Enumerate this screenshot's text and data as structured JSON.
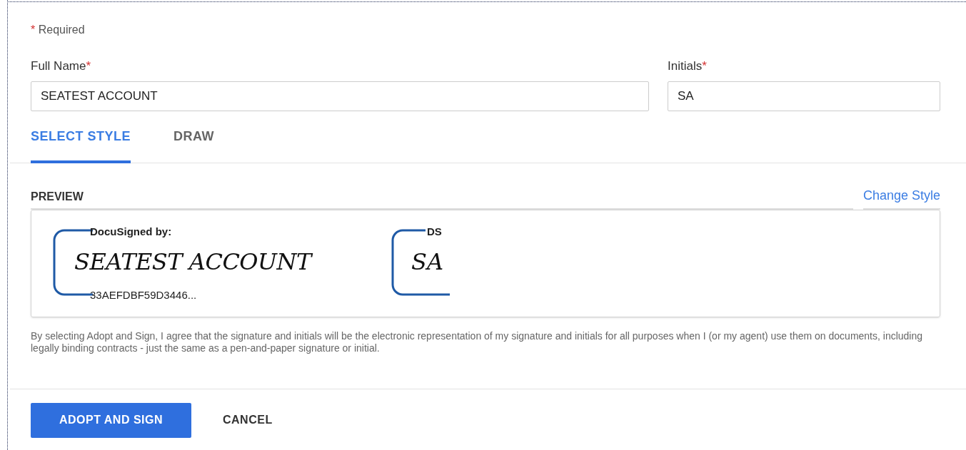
{
  "required_note": {
    "mark": "*",
    "text": "Required"
  },
  "fields": [
    {
      "label": "Full Name",
      "mark": "*",
      "value": "SEATEST ACCOUNT"
    },
    {
      "label": "Initials",
      "mark": "*",
      "value": "SA"
    }
  ],
  "tabs": [
    {
      "label": "SELECT STYLE",
      "selected": true
    },
    {
      "label": "DRAW",
      "selected": false
    }
  ],
  "preview": {
    "label": "PREVIEW",
    "link": "Change Style",
    "signature": {
      "header": "DocuSigned by:",
      "handwriting": "SEATEST ACCOUNT",
      "footer": "33AEFDBF59D3446..."
    },
    "initials": {
      "header": "DS",
      "handwriting": "SA"
    }
  },
  "disclaimer": "By selecting Adopt and Sign, I agree that the signature and initials will be the electronic representation of my signature and initials for all purposes when I (or my agent) use them on documents, including legally binding contracts - just the same as a pen-and-paper signature or initial.",
  "buttons": [
    {
      "label": "ADOPT AND SIGN",
      "kind": "primary"
    },
    {
      "label": "CANCEL",
      "kind": "secondary"
    }
  ]
}
